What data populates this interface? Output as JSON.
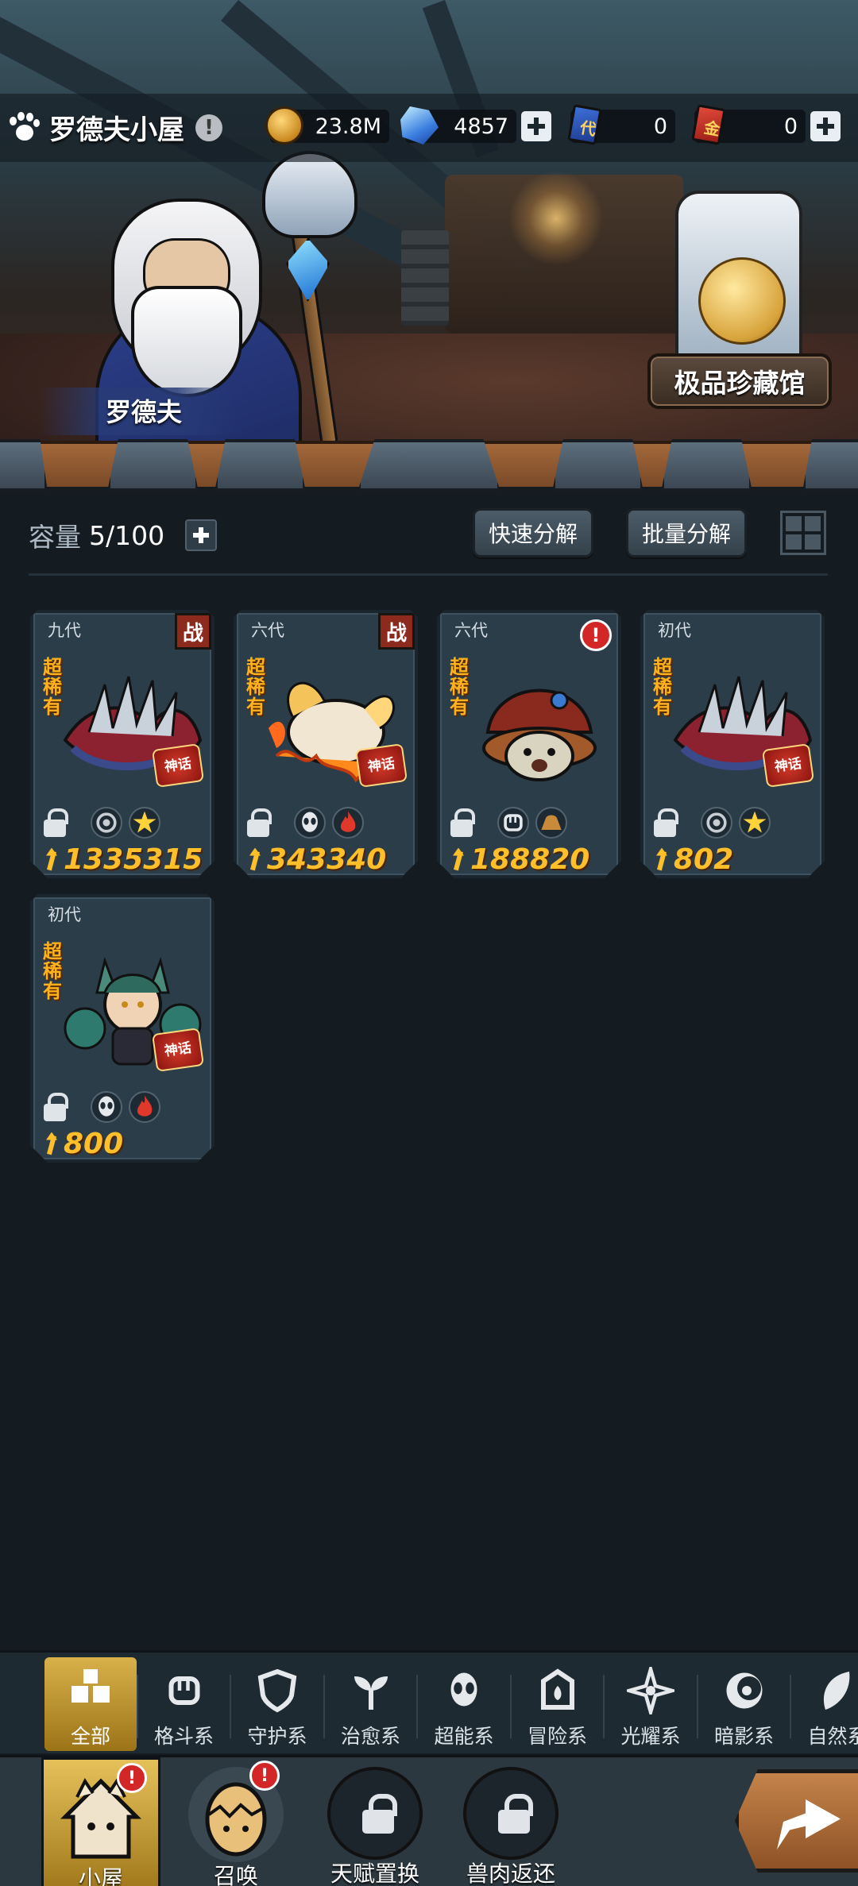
{
  "header": {
    "room_title": "罗德夫小屋",
    "room_alert": "!",
    "resources": {
      "coins": "23.8M",
      "crystals": "4857",
      "blue_card": "0",
      "gold_card": "0",
      "blue_card_glyph": "代",
      "gold_card_glyph": "金"
    }
  },
  "scene": {
    "npc_name": "罗德夫",
    "museum_button": "极品珍藏馆"
  },
  "toolbar": {
    "capacity_label": "容量",
    "capacity_value": "5/100",
    "quick_decompose": "快速分解",
    "batch_decompose": "批量分解"
  },
  "cards": [
    {
      "generation": "九代",
      "rarity": "超稀有",
      "badge": "战",
      "myth": "神话",
      "power": "1335315",
      "types": [
        "psychic-icon",
        "light-icon"
      ],
      "type_colors": [
        "#c7cdd2",
        "#ffd23a"
      ]
    },
    {
      "generation": "六代",
      "rarity": "超稀有",
      "badge": "战",
      "myth": "神话",
      "power": "343340",
      "types": [
        "alien-icon",
        "fire-icon"
      ],
      "type_colors": [
        "#e6e9ec",
        "#e0392b"
      ]
    },
    {
      "generation": "六代",
      "rarity": "超稀有",
      "badge": "!",
      "myth": "",
      "power": "188820",
      "types": [
        "fist-icon",
        "earth-icon"
      ],
      "type_colors": [
        "#e6e9ec",
        "#c98a3a"
      ]
    },
    {
      "generation": "初代",
      "rarity": "超稀有",
      "badge": "",
      "myth": "神话",
      "power": "802",
      "types": [
        "psychic-icon",
        "light-icon"
      ],
      "type_colors": [
        "#c7cdd2",
        "#ffd23a"
      ]
    },
    {
      "generation": "初代",
      "rarity": "超稀有",
      "badge": "",
      "myth": "神话",
      "power": "800",
      "types": [
        "alien-icon",
        "fire-icon"
      ],
      "type_colors": [
        "#e6e9ec",
        "#e0392b"
      ]
    }
  ],
  "categories": [
    {
      "label": "全部",
      "icon": "all-blocks-icon",
      "active": true
    },
    {
      "label": "格斗系",
      "icon": "fist-icon"
    },
    {
      "label": "守护系",
      "icon": "shield-icon"
    },
    {
      "label": "治愈系",
      "icon": "sprout-icon"
    },
    {
      "label": "超能系",
      "icon": "alien-icon"
    },
    {
      "label": "冒险系",
      "icon": "adventure-icon"
    },
    {
      "label": "光耀系",
      "icon": "star-icon"
    },
    {
      "label": "暗影系",
      "icon": "shadow-icon"
    },
    {
      "label": "自然系",
      "icon": "leaf-icon"
    }
  ],
  "nav": [
    {
      "label": "小屋",
      "icon": "house-icon",
      "alert": "!",
      "active": true
    },
    {
      "label": "召唤",
      "icon": "egg-icon",
      "alert": "!"
    },
    {
      "label": "天赋置换",
      "icon": "lock-icon"
    },
    {
      "label": "兽肉返还",
      "icon": "lock-icon"
    }
  ],
  "colors": {
    "accent_gold": "#ffbf2a",
    "rarity_orange": "#ffb21c",
    "alert_red": "#d32626",
    "panel_dark": "#141c22",
    "card_bg": "#2c3d4a"
  }
}
